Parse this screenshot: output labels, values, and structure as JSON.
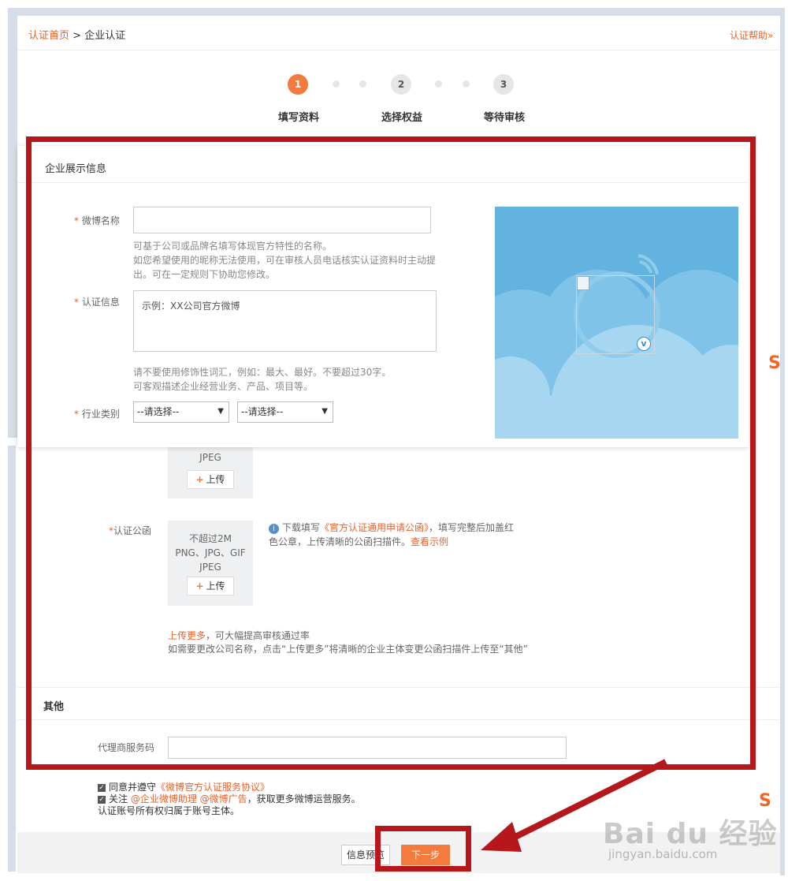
{
  "breadcrumb": {
    "home": "认证首页",
    "sep": " > ",
    "current": "企业认证"
  },
  "help_link": "认证帮助»",
  "steps": [
    {
      "num": "1",
      "label": "填写资料"
    },
    {
      "num": "2",
      "label": "选择权益"
    },
    {
      "num": "3",
      "label": "等待审核"
    }
  ],
  "display_section": {
    "title": "企业展示信息",
    "weibo_name": {
      "label": "微博名称",
      "value": "",
      "hint1": "可基于公司或品牌名填写体现官方特性的名称。",
      "hint2": "如您希望使用的昵称无法使用，可在审核人员电话核实认证资料时主动提",
      "hint3": "出。可在一定规则下协助您修改。"
    },
    "cert_info": {
      "label": "认证信息",
      "placeholder": "示例：XX公司官方微博",
      "hint1": "请不要使用修饰性词汇，例如：最大、最好。不要超过30字。",
      "hint2": "可客观描述企业经营业务、产品、项目等。"
    },
    "industry": {
      "label": "行业类别",
      "select1": "--请选择--",
      "select2": "--请选择--"
    },
    "required_mark": "*"
  },
  "upload": {
    "partial_format": "JPEG",
    "btn": "上传",
    "letter_label": "认证公函",
    "size": "不超过2M",
    "formats": "PNG、JPG、GIF",
    "formats2": "JPEG",
    "note_pre": "下载填写",
    "note_link": "《官方认证通用申请公函》",
    "note_mid": "，填写完整后加盖红",
    "note_line2": "色公章，上传清晰的公函扫描件。",
    "note_example": "查看示例",
    "more_link": "上传更多",
    "more_text": "，可大幅提高审核通过率",
    "rename_hint": "如需要更改公司名称，点击“上传更多”将清晰的企业主体变更公函扫描件上传至“其他”"
  },
  "other_section": {
    "title": "其他",
    "agent_label": "代理商服务码",
    "agent_value": ""
  },
  "agreements": {
    "agree_pre": "同意并遵守",
    "agree_link": "《微博官方认证服务协议》",
    "follow_pre": "关注",
    "follow_link": "@企业微博助理 @微博广告",
    "follow_post": "，获取更多微博运营服务。",
    "ownership": "认证账号所有权归属于账号主体。"
  },
  "buttons": {
    "preview": "信息预览",
    "next": "下一步"
  },
  "watermark": {
    "logo_text": "Bai du 经验",
    "url": "jingyan.baidu.com"
  },
  "colors": {
    "accent": "#f37b3e",
    "link": "#e8612c",
    "annotation": "#b5171a",
    "preview_bg": "#62b3df"
  }
}
